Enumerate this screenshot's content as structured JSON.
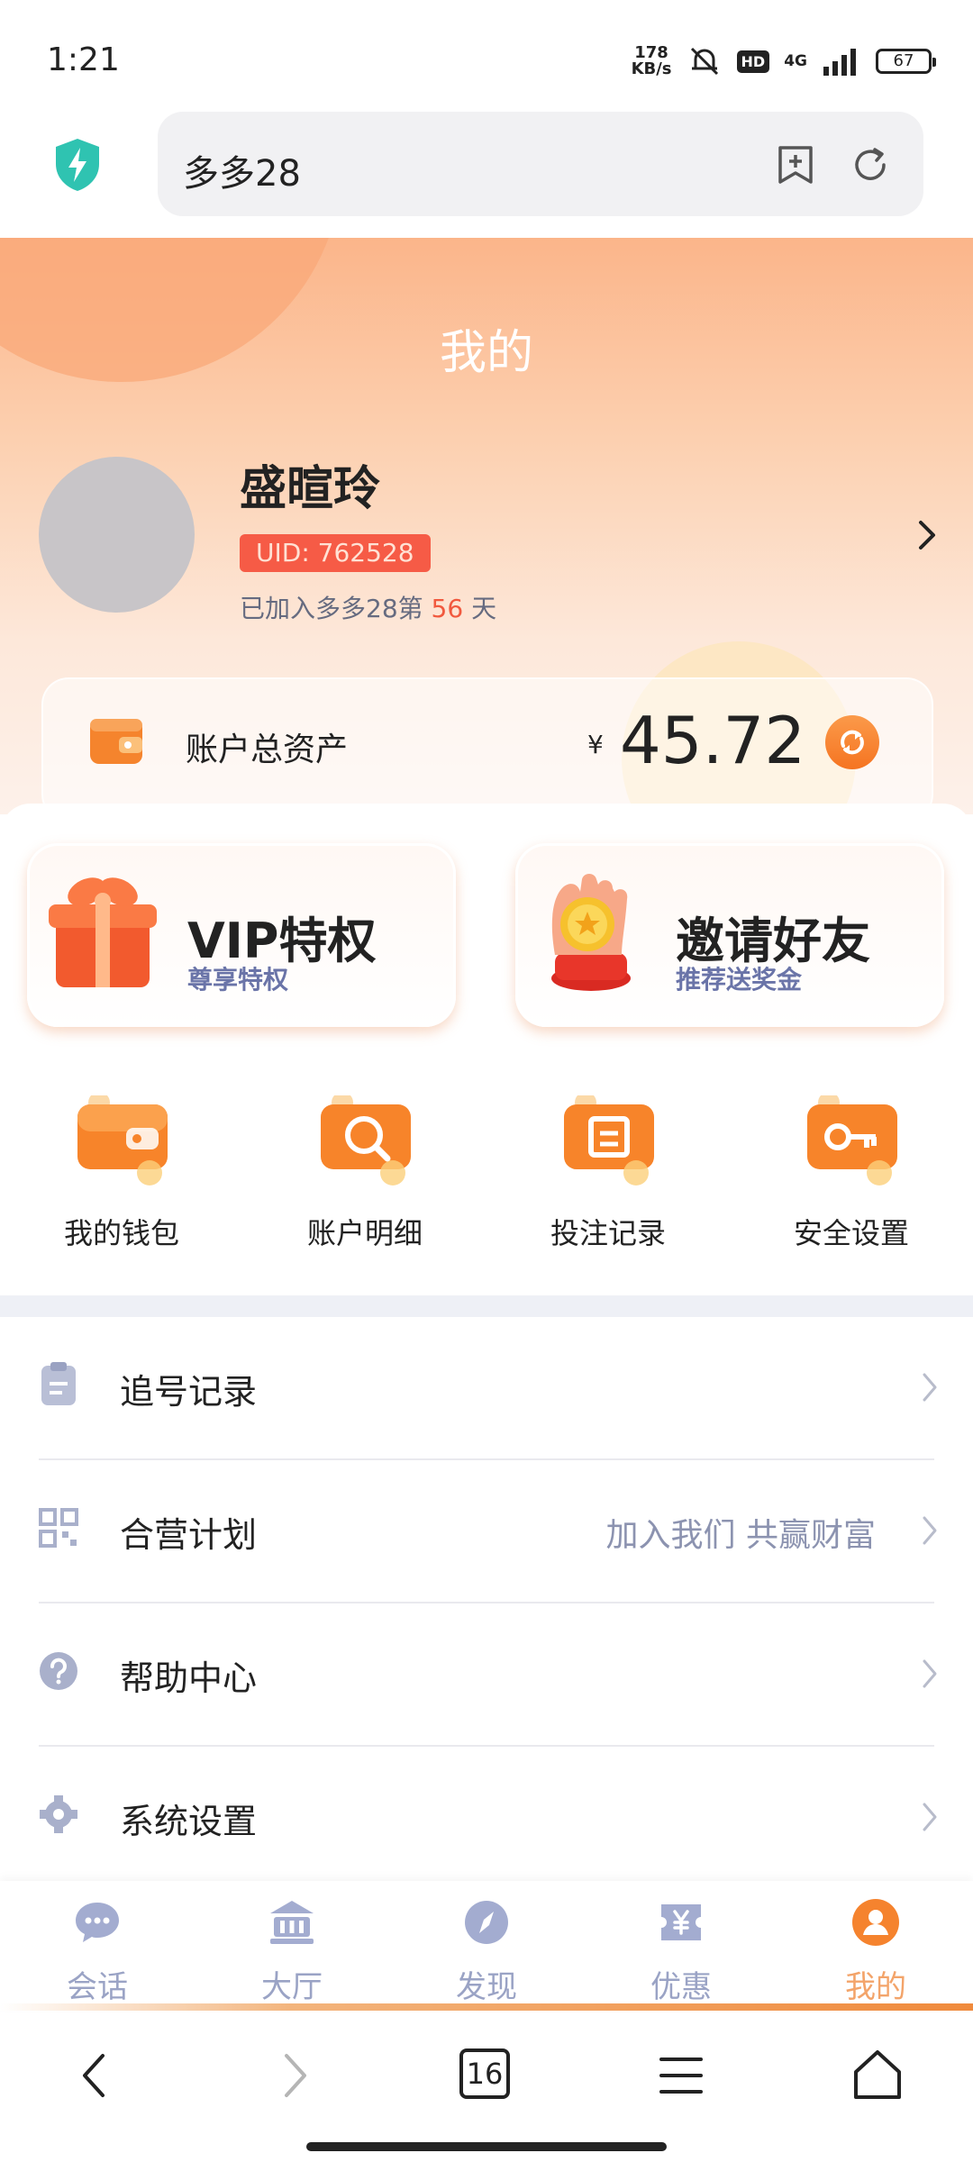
{
  "status_bar": {
    "time": "1:21",
    "net_speed_value": "178",
    "net_speed_unit": "KB/s",
    "hd": "HD",
    "network": "4G",
    "battery": "67"
  },
  "browser": {
    "url_text": "多多28",
    "tab_count": "16"
  },
  "profile": {
    "page_title": "我的",
    "username": "盛暄玲",
    "uid": "UID: 762528",
    "join_prefix": "已加入多多28第",
    "join_days": "56",
    "join_suffix": "天"
  },
  "assets": {
    "label": "账户总资产",
    "currency": "¥",
    "value": "45.72"
  },
  "promos": [
    {
      "title": "VIP特权",
      "subtitle": "尊享特权"
    },
    {
      "title": "邀请好友",
      "subtitle": "推荐送奖金"
    }
  ],
  "quick_actions": [
    {
      "label": "我的钱包"
    },
    {
      "label": "账户明细"
    },
    {
      "label": "投注记录"
    },
    {
      "label": "安全设置"
    }
  ],
  "menu": [
    {
      "label": "追号记录",
      "extra": ""
    },
    {
      "label": "合营计划",
      "extra": "加入我们 共赢财富"
    },
    {
      "label": "帮助中心",
      "extra": ""
    },
    {
      "label": "系统设置",
      "extra": ""
    }
  ],
  "tabs": [
    {
      "label": "会话"
    },
    {
      "label": "大厅"
    },
    {
      "label": "发现"
    },
    {
      "label": "优惠"
    },
    {
      "label": "我的"
    }
  ],
  "colors": {
    "accent": "#f57421",
    "uid_badge": "#f65b46",
    "tab_inactive": "#9aa3c5",
    "tab_active": "#f3a46a"
  }
}
